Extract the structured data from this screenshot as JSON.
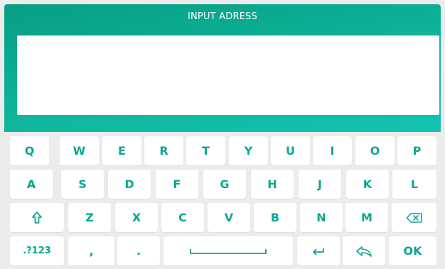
{
  "header": {
    "title": "INPUT ADRESS"
  },
  "input": {
    "value": ""
  },
  "keyboard": {
    "row1": [
      "Q",
      "W",
      "E",
      "R",
      "T",
      "Y",
      "U",
      "I",
      "O",
      "P"
    ],
    "row2": [
      "A",
      "S",
      "D",
      "F",
      "G",
      "H",
      "J",
      "K",
      "L"
    ],
    "row3": [
      "Z",
      "X",
      "C",
      "V",
      "B",
      "N",
      "M"
    ],
    "symbols_label": ".?123",
    "comma": ",",
    "period": ".",
    "ok_label": "OK"
  },
  "colors": {
    "accent": "#0aa793",
    "header_start": "#079e84",
    "header_end": "#13c4b3",
    "keyboard_bg": "#ececec",
    "key_bg": "#ffffff"
  },
  "icons": {
    "shift": "shift-icon",
    "backspace": "backspace-icon",
    "space": "space-icon",
    "enter": "enter-icon",
    "back": "back-icon"
  }
}
